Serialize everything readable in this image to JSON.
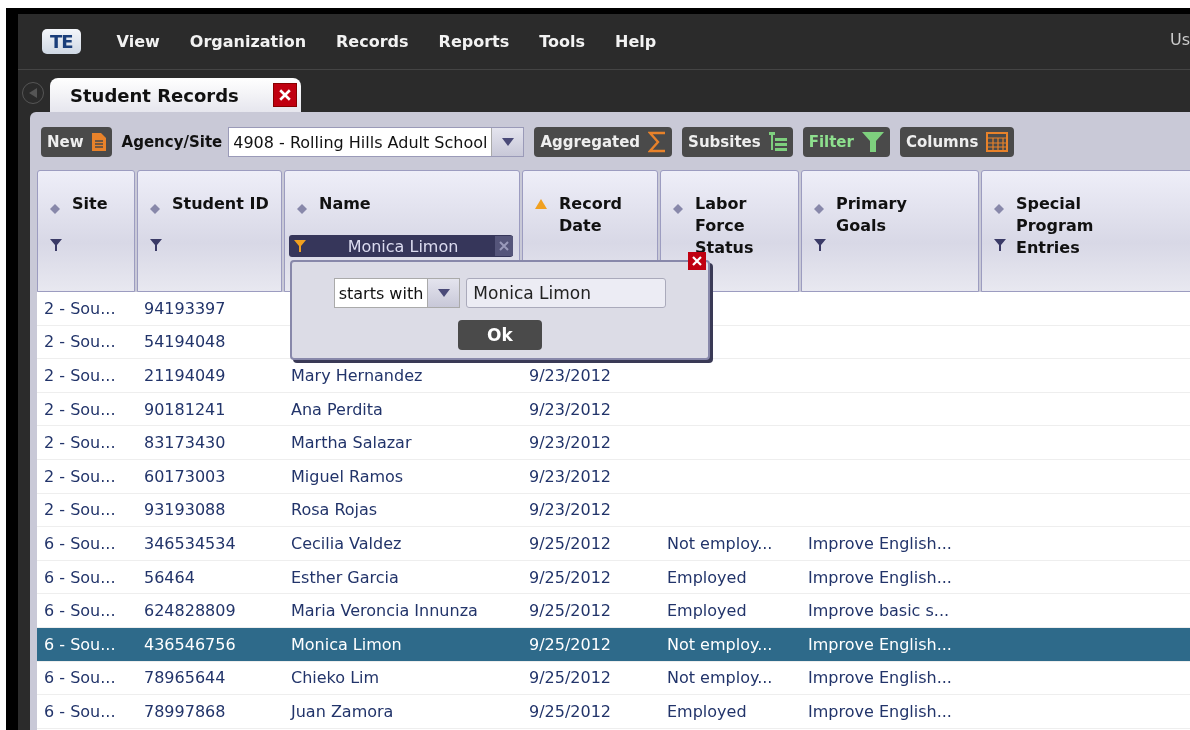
{
  "menu": {
    "logo": "TE",
    "items": [
      "View",
      "Organization",
      "Records",
      "Reports",
      "Tools",
      "Help"
    ],
    "user": "Us"
  },
  "tabs": [
    {
      "label": "Student Records",
      "selected": true
    }
  ],
  "toolbar": {
    "new_button": "New",
    "agency_label": "Agency/Site",
    "agency_value": "4908 - Rolling Hills Adult School",
    "buttons": [
      {
        "label": "Aggregated",
        "kind": "sum",
        "active": false
      },
      {
        "label": "Subsites",
        "kind": "tree",
        "active": false
      },
      {
        "label": "Filter",
        "kind": "filter",
        "active": true
      },
      {
        "label": "Columns",
        "kind": "grid",
        "active": false
      }
    ]
  },
  "table": {
    "columns": [
      {
        "label": "Site",
        "sort_ascending": false,
        "filter_icon": true
      },
      {
        "label": "Student ID",
        "sort_ascending": false,
        "filter_icon": true
      },
      {
        "label": "Name",
        "sort_ascending": false,
        "filter_icon": false
      },
      {
        "label": "Record Date",
        "sort_ascending": true,
        "filter_icon": false
      },
      {
        "label": "Labor Force Status",
        "sort_ascending": false,
        "filter_icon": false
      },
      {
        "label": "Primary Goals",
        "sort_ascending": false,
        "filter_icon": true
      },
      {
        "label": "Special Program Entries",
        "sort_ascending": false,
        "filter_icon": true
      }
    ],
    "rows": [
      {
        "cells": [
          "2 - Sou...",
          "94193397",
          null,
          null,
          null,
          null
        ],
        "selected": false
      },
      {
        "cells": [
          "2 - Sou...",
          "54194048",
          null,
          null,
          null,
          null
        ],
        "selected": false
      },
      {
        "cells": [
          "2 - Sou...",
          "21194049",
          "Mary Hernandez",
          "9/23/2012",
          null,
          null
        ],
        "selected": false
      },
      {
        "cells": [
          "2 - Sou...",
          "90181241",
          "Ana Perdita",
          "9/23/2012",
          null,
          null
        ],
        "selected": false
      },
      {
        "cells": [
          "2 - Sou...",
          "83173430",
          "Martha Salazar",
          "9/23/2012",
          null,
          null
        ],
        "selected": false
      },
      {
        "cells": [
          "2 - Sou...",
          "60173003",
          "Miguel Ramos",
          "9/23/2012",
          null,
          null
        ],
        "selected": false
      },
      {
        "cells": [
          "2 - Sou...",
          "93193088",
          "Rosa Rojas",
          "9/23/2012",
          null,
          null
        ],
        "selected": false
      },
      {
        "cells": [
          "6 - Sou...",
          "346534534",
          "Cecilia Valdez",
          "9/25/2012",
          "Not employ...",
          "Improve English..."
        ],
        "selected": false
      },
      {
        "cells": [
          "6 - Sou...",
          "56464",
          "Esther Garcia",
          "9/25/2012",
          "Employed",
          "Improve English..."
        ],
        "selected": false
      },
      {
        "cells": [
          "6 - Sou...",
          "624828809",
          "Maria Veroncia Innunza",
          "9/25/2012",
          "Employed",
          "Improve basic s..."
        ],
        "selected": false
      },
      {
        "cells": [
          "6 - Sou...",
          "436546756",
          "Monica Limon",
          "9/25/2012",
          "Not employ...",
          "Improve English..."
        ],
        "selected": true
      },
      {
        "cells": [
          "6 - Sou...",
          "78965644",
          "Chieko Lim",
          "9/25/2012",
          "Not employ...",
          "Improve English..."
        ],
        "selected": false
      },
      {
        "cells": [
          "6 - Sou...",
          "78997868",
          "Juan Zamora",
          "9/25/2012",
          "Employed",
          "Improve English..."
        ],
        "selected": false
      }
    ]
  },
  "filter_popup": {
    "column_chip": "Monica Limon",
    "operator": "starts with",
    "value": "Monica Limon",
    "ok": "Ok"
  }
}
